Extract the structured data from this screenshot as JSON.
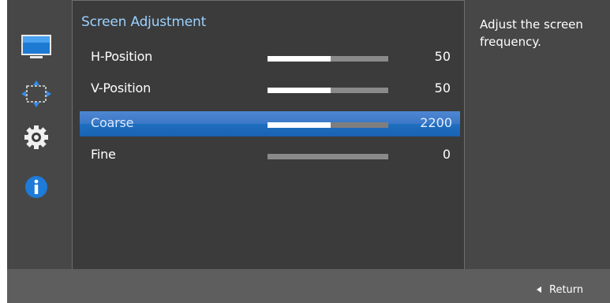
{
  "nav": {
    "icons": [
      "display-icon",
      "position-arrows-icon",
      "gear-icon",
      "info-icon"
    ]
  },
  "panel": {
    "title": "Screen Adjustment",
    "rows": [
      {
        "label": "H-Position",
        "value": "50",
        "level": 0.52,
        "selected": false
      },
      {
        "label": "V-Position",
        "value": "50",
        "level": 0.52,
        "selected": false
      },
      {
        "label": "Coarse",
        "value": "2200",
        "level": 0.52,
        "selected": true
      },
      {
        "label": "Fine",
        "value": "0",
        "level": 0.0,
        "selected": false
      }
    ]
  },
  "help": {
    "text": "Adjust the screen frequency."
  },
  "footer": {
    "return_label": "Return"
  },
  "colors": {
    "title": "#9ad1ff",
    "selected_row": "#2f73c4",
    "panel_bg": "#3b3b3b",
    "rail_bg": "#474747",
    "footer_bg": "#5e5e5e"
  }
}
